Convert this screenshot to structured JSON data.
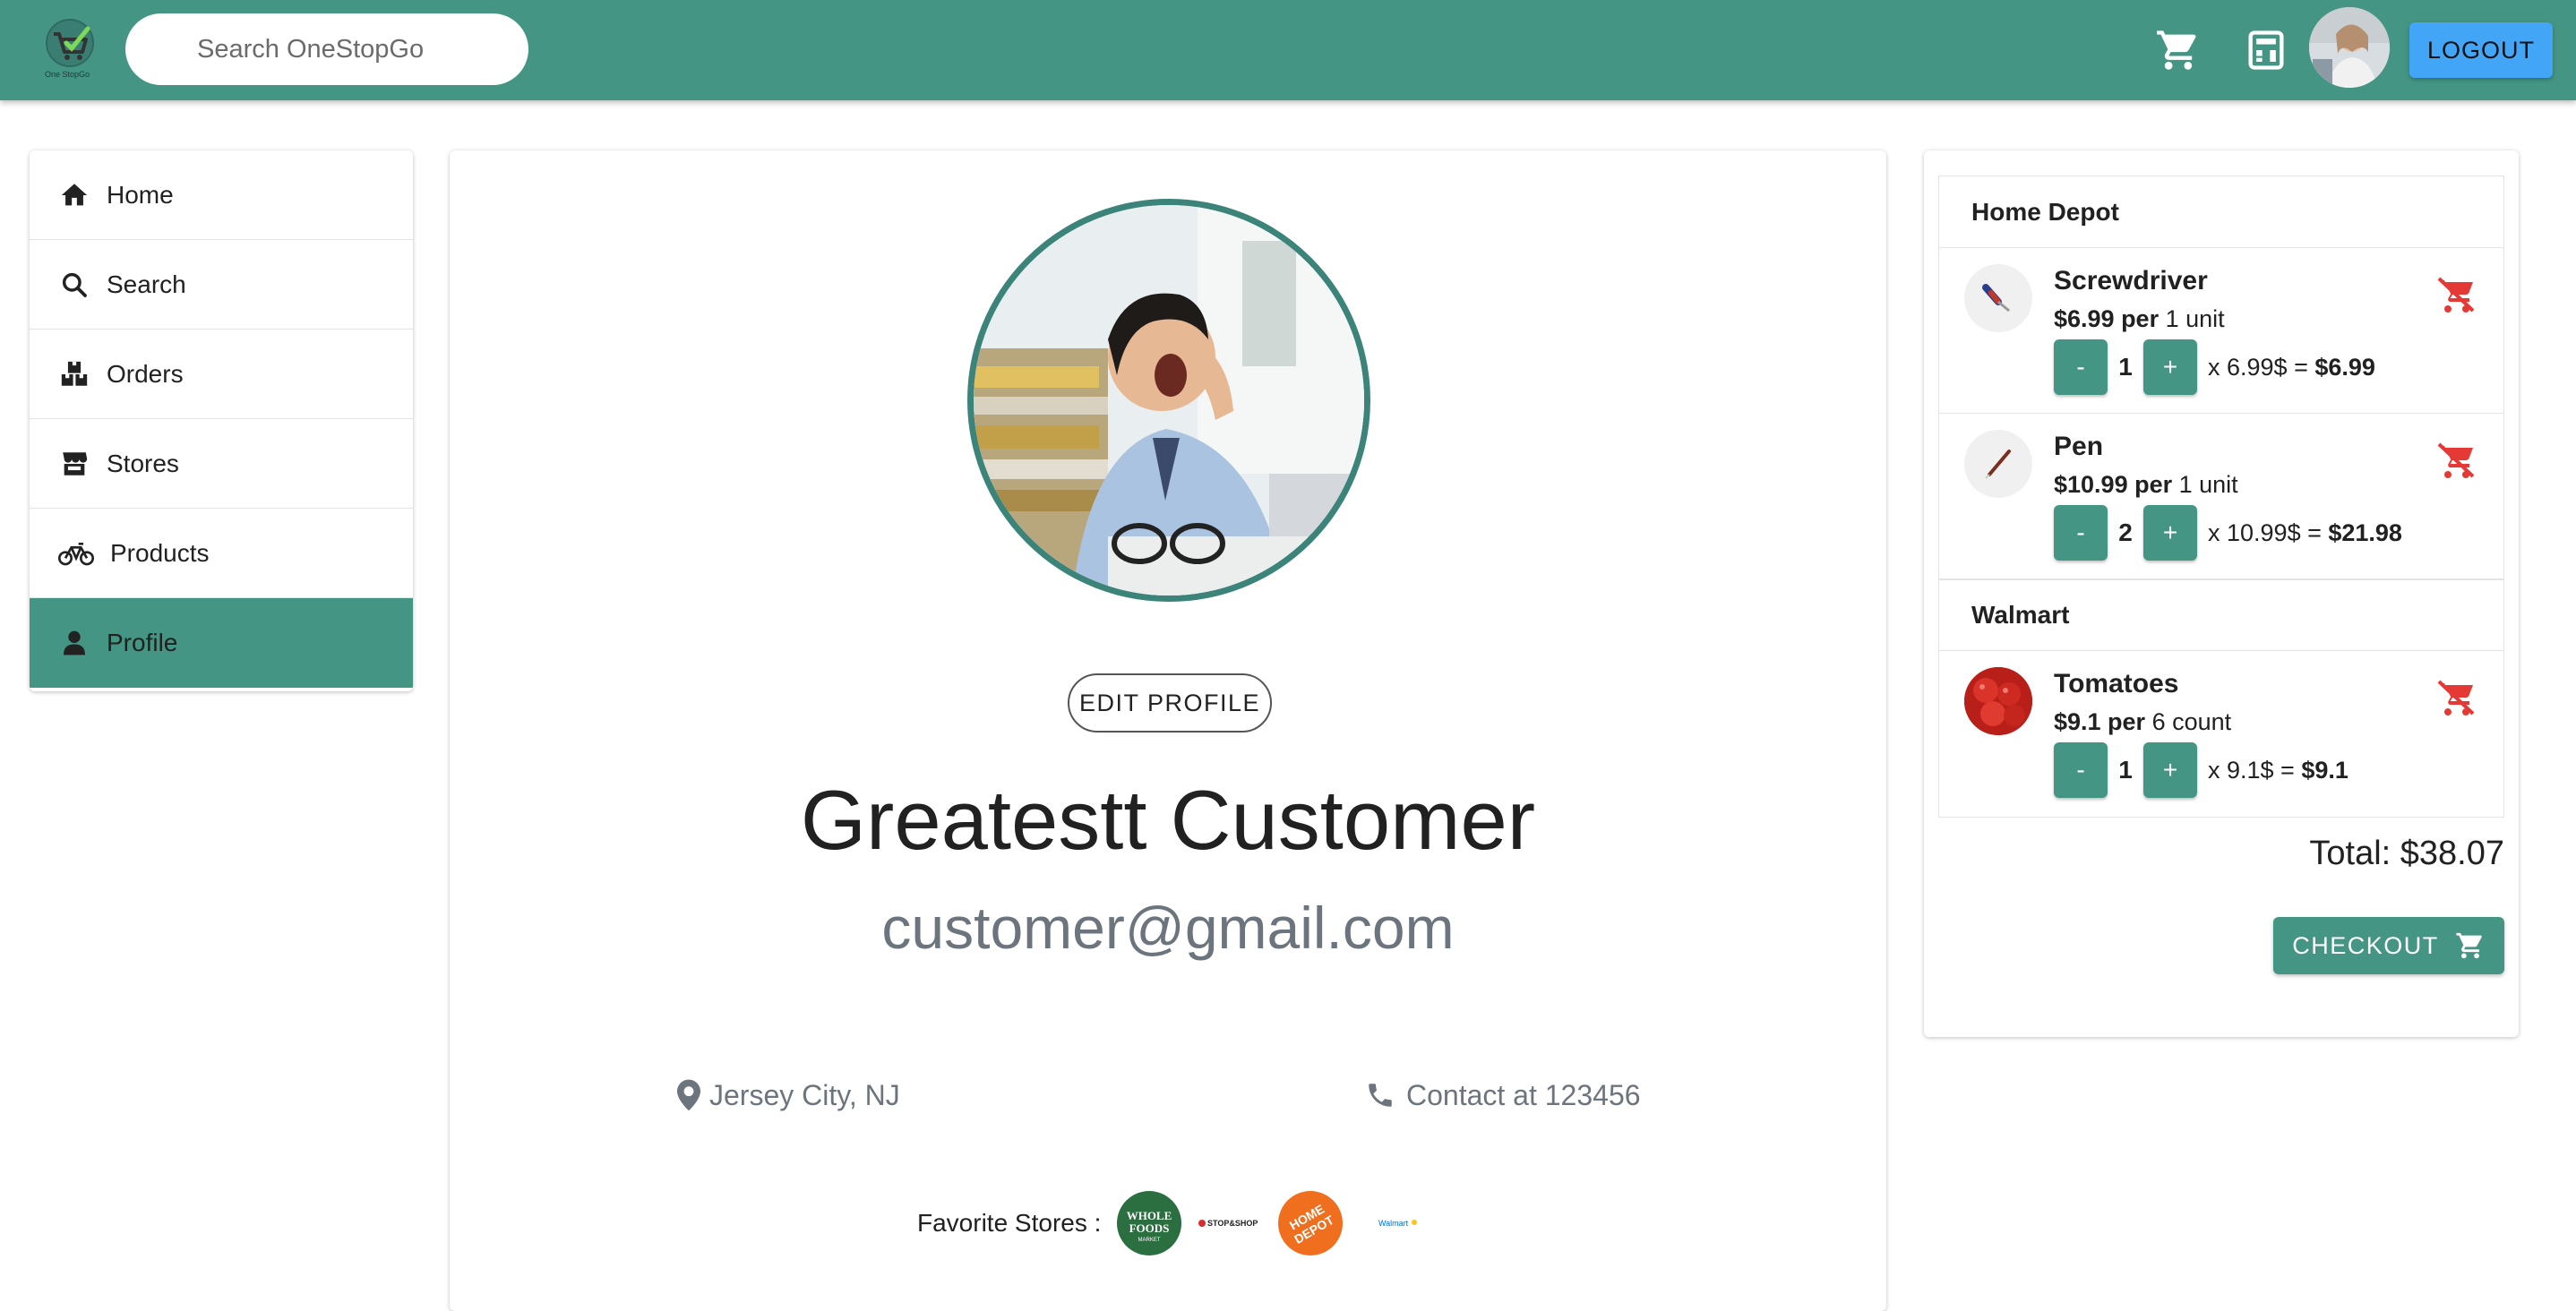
{
  "header": {
    "logo_text": "One StopGo",
    "search_placeholder": "Search OneStopGo",
    "logout_label": "LOGOUT"
  },
  "sidebar": {
    "items": [
      {
        "label": "Home",
        "icon": "home-icon"
      },
      {
        "label": "Search",
        "icon": "search-icon"
      },
      {
        "label": "Orders",
        "icon": "orders-icon"
      },
      {
        "label": "Stores",
        "icon": "store-icon"
      },
      {
        "label": "Products",
        "icon": "bicycle-icon"
      },
      {
        "label": "Profile",
        "icon": "person-icon",
        "active": true
      }
    ]
  },
  "profile": {
    "edit_label": "EDIT PROFILE",
    "name": "Greatestt Customer",
    "email": "customer@gmail.com",
    "location": "Jersey City, NJ",
    "contact": "Contact at 123456",
    "favorite_stores_label": "Favorite Stores :",
    "favorite_stores": [
      "Whole Foods Market",
      "Stop & Shop",
      "The Home Depot",
      "Walmart"
    ]
  },
  "cart": {
    "stores": [
      {
        "name": "Home Depot",
        "items": [
          {
            "name": "Screwdriver",
            "price": "$6.99 per",
            "unit": "1 unit",
            "qty": "1",
            "calc": "x 6.99$ = ",
            "subtotal": "$6.99"
          },
          {
            "name": "Pen",
            "price": "$10.99 per",
            "unit": "1 unit",
            "qty": "2",
            "calc": "x 10.99$ = ",
            "subtotal": "$21.98"
          }
        ]
      },
      {
        "name": "Walmart",
        "items": [
          {
            "name": "Tomatoes",
            "price": "$9.1 per",
            "unit": "6 count",
            "qty": "1",
            "calc": "x 9.1$ = ",
            "subtotal": "$9.1"
          }
        ]
      }
    ],
    "minus": "-",
    "plus": "+",
    "total": "Total: $38.07",
    "checkout_label": "CHECKOUT"
  },
  "colors": {
    "primary": "#449584",
    "logout": "#42a5f5",
    "remove": "#e53935"
  }
}
